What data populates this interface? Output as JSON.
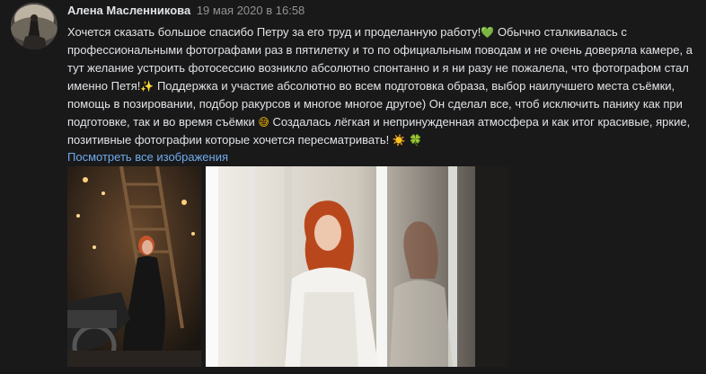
{
  "post": {
    "author": "Алена Масленникова",
    "date": "19 мая 2020 в 16:58",
    "text_parts": {
      "p1": "Хочется сказать большое спасибо Петру за его труд и проделанную работу!",
      "p2": " Обычно сталкивалась с профессиональными фотографами раз в пятилетку и то по официальным поводам и не очень доверяла камере, а тут желание устроить фотосессию возникло абсолютно спонтанно и я ни разу не пожалела, что фотографом стал именно Петя!",
      "p3": " Поддержка и участие абсолютно во всем подготовка образа, выбор наилучшего места съёмки, помощь в позировании, подбор ракурсов и многое многое другое) Он сделал все, чтоб исключить панику как при подготовке, так и во время съёмки ",
      "p4": " Создалась лёгкая и непринужденная атмосфера и как итог красивые, яркие, позитивные фотографии которые хочется пересматривать! "
    },
    "emojis": {
      "green_heart": "💚",
      "sparkles": "✨",
      "smile": "😅",
      "sun": "☀️",
      "clover": "🍀"
    },
    "show_all_label": "Посмотреть все изображения",
    "photos": [
      {
        "name": "woman-in-black-dress-photo"
      },
      {
        "name": "woman-in-white-dress-by-window-photo"
      }
    ]
  },
  "colors": {
    "background": "#19191a",
    "text": "#e1e3e6",
    "date": "#939393",
    "link": "#71aaeb"
  }
}
